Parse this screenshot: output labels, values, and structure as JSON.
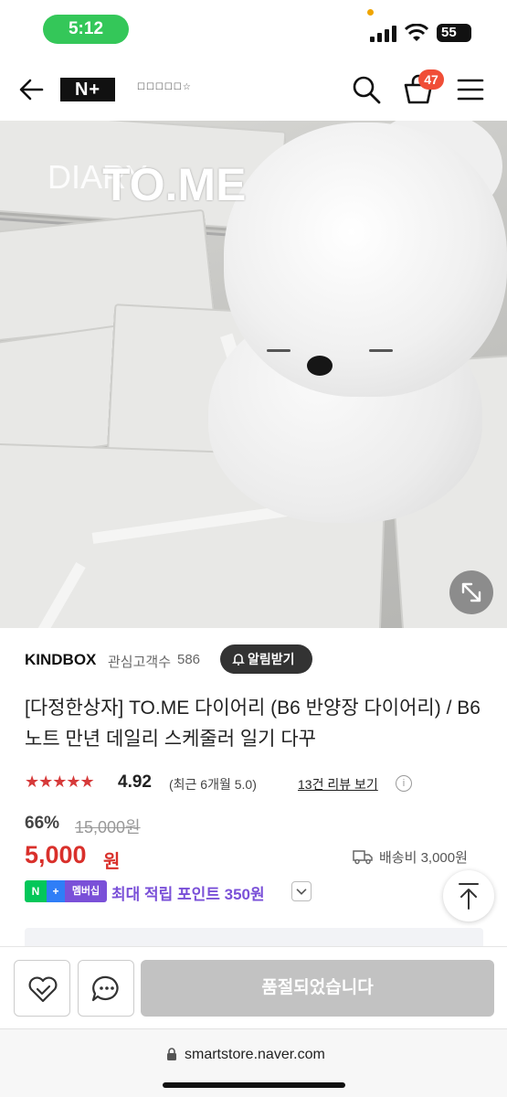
{
  "status_bar": {
    "time": "5:12",
    "battery": "55"
  },
  "header": {
    "logo_text": "N+",
    "store_logo_text": "☐☐☐☐☐☆",
    "cart_count": "47"
  },
  "hero": {
    "title_text": "TO.ME",
    "sub_text": "DIARY"
  },
  "seller": {
    "name": "KINDBOX",
    "favorite_label": "관심고객수",
    "favorite_count": "586",
    "alarm_label": "알림받기"
  },
  "product": {
    "title": "[다정한상자] TO.ME 다이어리 (B6 반양장 다이어리) / B6노트 만년 데일리 스케줄러 일기 다꾸",
    "rating_score": "4.92",
    "rating_recent": "(최근 6개월 5.0)",
    "review_link": "13건 리뷰 보기",
    "discount": "66%",
    "original_price": "15,000원",
    "sale_price": "5,000",
    "sale_unit": "원",
    "shipping": "배송비 3,000원",
    "points_badge_member": "멤버십",
    "points_text": "최대 적립 포인트 350원"
  },
  "bottom_bar": {
    "soldout_label": "품절되었습니다"
  },
  "browser": {
    "url": "smartstore.naver.com"
  },
  "colors": {
    "accent_red": "#d9302b",
    "naver_green": "#03c75a",
    "membership_purple": "#7a50d8",
    "cart_badge": "#f04e37"
  }
}
